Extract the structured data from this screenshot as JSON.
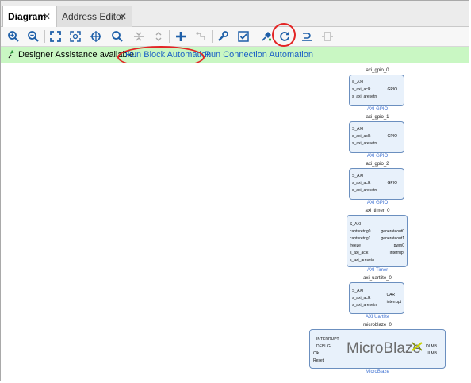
{
  "tabs": [
    {
      "label": "Diagram",
      "active": true
    },
    {
      "label": "Address Editor",
      "active": false
    }
  ],
  "toolbar": {
    "icons": [
      "zoom-in-icon",
      "zoom-out-icon",
      "zoom-fit-icon",
      "fit-selection-icon",
      "auto-fit-icon",
      "search-icon",
      "collapse-all-icon",
      "expand-all-icon",
      "add-ip-icon",
      "make-connection-icon",
      "settings-wrench-icon",
      "validate-design-icon",
      "pin-icon",
      "regenerate-layout-icon",
      "optimize-routing-icon",
      "port-icon"
    ]
  },
  "assistance": {
    "message": "Designer Assistance available.",
    "run_block": "Run Block Automation",
    "run_connection": "Run Connection Automation"
  },
  "blocks": [
    {
      "instance": "axi_gpio_0",
      "type": "AXI GPIO",
      "inputs": [
        "S_AXI",
        "s_axi_aclk",
        "s_axi_aresetn"
      ],
      "outputs": [
        "GPIO"
      ]
    },
    {
      "instance": "axi_gpio_1",
      "type": "AXI GPIO",
      "inputs": [
        "S_AXI",
        "s_axi_aclk",
        "s_axi_aresetn"
      ],
      "outputs": [
        "GPIO"
      ]
    },
    {
      "instance": "axi_gpio_2",
      "type": "AXI GPIO",
      "inputs": [
        "S_AXI",
        "s_axi_aclk",
        "s_axi_aresetn"
      ],
      "outputs": [
        "GPIO"
      ]
    },
    {
      "instance": "axi_timer_0",
      "type": "AXI Timer",
      "inputs": [
        "S_AXI",
        "capturetrig0",
        "capturetrig1",
        "freeze",
        "s_axi_aclk",
        "s_axi_aresetn"
      ],
      "outputs": [
        "generateout0",
        "generateout1",
        "pwm0",
        "interrupt"
      ]
    },
    {
      "instance": "axi_uartlite_0",
      "type": "AXI Uartlite",
      "inputs": [
        "S_AXI",
        "s_axi_aclk",
        "s_axi_aresetn"
      ],
      "outputs": [
        "UART",
        "interrupt"
      ]
    },
    {
      "instance": "microblaze_0",
      "type": "MicroBlaze",
      "logo": "MicroBlaze",
      "inputs": [
        "INTERRUPT",
        "DEBUG",
        "Clk",
        "Reset"
      ],
      "outputs": [
        "DLMB",
        "ILMB"
      ]
    }
  ]
}
